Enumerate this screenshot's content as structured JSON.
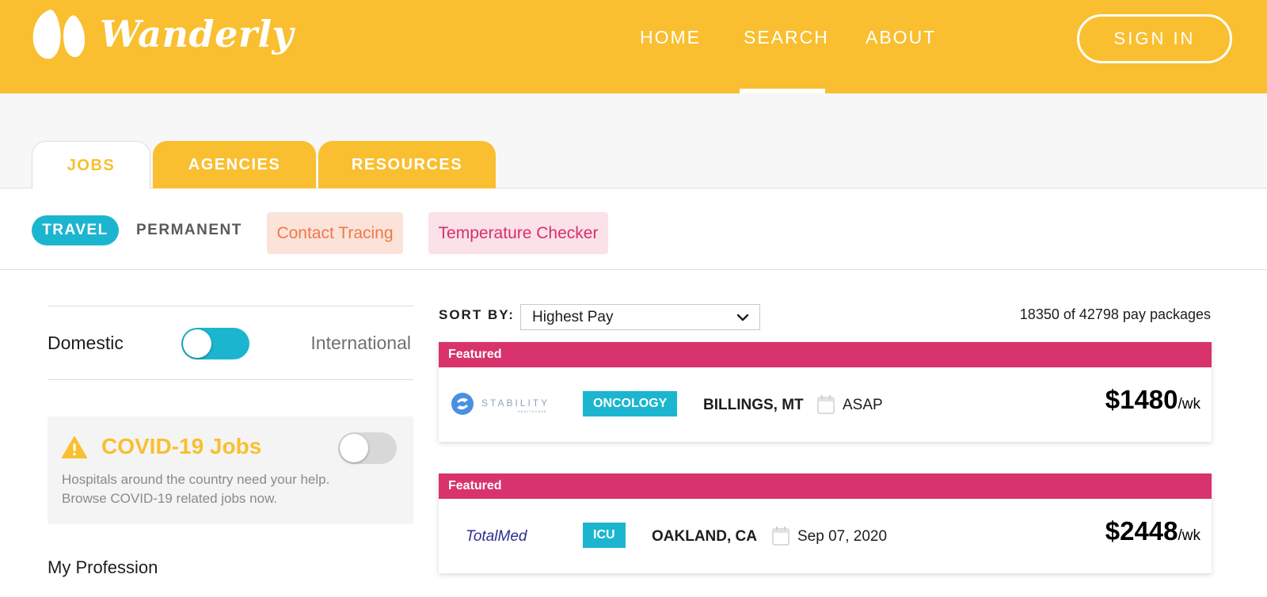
{
  "brand": {
    "name": "Wanderly",
    "primary_color": "#f9bf30",
    "accent_teal": "#1cb5cf",
    "accent_pink": "#d8336c"
  },
  "header": {
    "nav": [
      {
        "label": "HOME",
        "active": false
      },
      {
        "label": "SEARCH",
        "active": true
      },
      {
        "label": "ABOUT",
        "active": false
      }
    ],
    "signin_label": "SIGN IN"
  },
  "tabs": [
    {
      "label": "JOBS",
      "active": true
    },
    {
      "label": "AGENCIES",
      "active": false
    },
    {
      "label": "RESOURCES",
      "active": false
    }
  ],
  "filters": {
    "job_types": [
      {
        "label": "TRAVEL",
        "active": true
      },
      {
        "label": "PERMANENT",
        "active": false
      }
    ],
    "chips": [
      {
        "label": "Contact Tracing",
        "color": "#f07845"
      },
      {
        "label": "Temperature Checker",
        "color": "#d6316b"
      }
    ]
  },
  "sidebar": {
    "domestic_label": "Domestic",
    "international_label": "International",
    "domestic_toggle_on": true,
    "covid": {
      "icon": "warning-icon",
      "title": "COVID-19 Jobs",
      "description": "Hospitals around the country need your help. Browse COVID-19 related jobs now.",
      "toggle_on": false
    },
    "profession_label": "My Profession"
  },
  "results": {
    "sort_label": "SORT BY:",
    "sort_value": "Highest Pay",
    "count_text": "18350 of 42798 pay packages",
    "jobs": [
      {
        "featured_label": "Featured",
        "agency": "STABILITY",
        "agency_sub": "HEALTHCARE",
        "specialty": "ONCOLOGY",
        "location": "BILLINGS, MT",
        "start": "ASAP",
        "pay": "$1480",
        "pay_unit": "/wk"
      },
      {
        "featured_label": "Featured",
        "agency": "TotalMed",
        "specialty": "ICU",
        "location": "OAKLAND, CA",
        "start": "Sep 07, 2020",
        "pay": "$2448",
        "pay_unit": "/wk"
      }
    ]
  }
}
